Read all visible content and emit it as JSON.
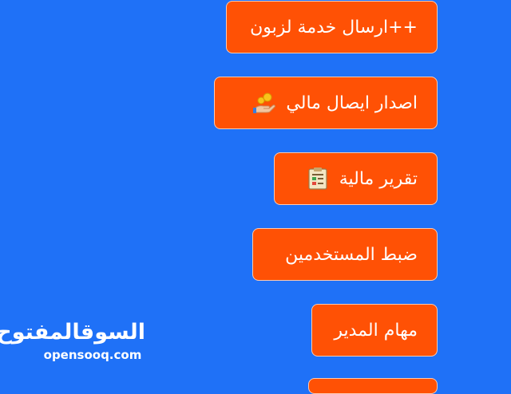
{
  "menu": {
    "send_service": "++ارسال خدمة لزبون",
    "issue_receipt": "اصدار ايصال مالي",
    "financial_reports": "تقرير مالية",
    "user_settings": "ضبط المستخدمين",
    "manager_tasks": "مهام المدير"
  },
  "watermark": {
    "arabic": "السوقالمفتوح",
    "latin": "opensooq.com"
  },
  "colors": {
    "background": "#1f71f7",
    "button": "#ff5105",
    "button_border": "#ffc9ae",
    "text": "#ffffff"
  },
  "icons": {
    "issue_receipt": "hand-coins-icon",
    "financial_reports": "report-document-icon"
  }
}
